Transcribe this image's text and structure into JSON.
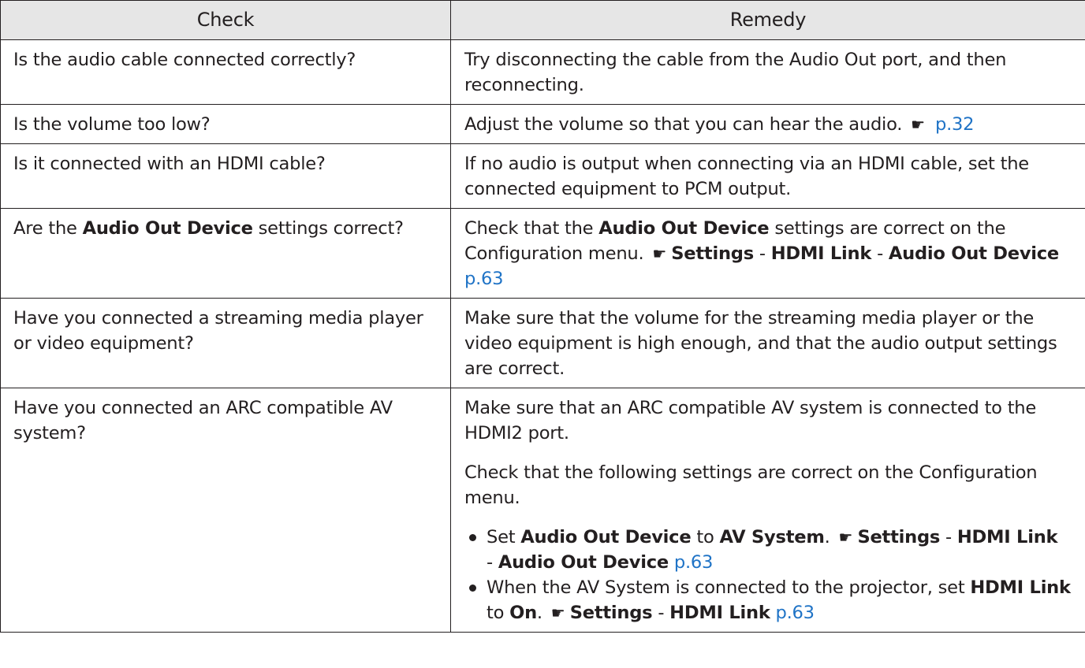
{
  "headers": {
    "check": "Check",
    "remedy": "Remedy"
  },
  "rows": [
    {
      "check": "Is the audio cable connected correctly?",
      "remedy": "Try disconnecting the cable from the Audio Out port, and then reconnecting."
    },
    {
      "check": "Is the volume too low?",
      "remedy": "Adjust the volume so that you can hear the audio.",
      "remedy_link": "p.32"
    },
    {
      "check": "Is it connected with an HDMI cable?",
      "remedy": "If no audio is output when connecting via an HDMI cable, set the connected equipment to PCM output."
    },
    {
      "check_pre": "Are the",
      "check_bold": "Audio Out Device",
      "check_post": "settings correct?",
      "remedy_pre": "Check that the",
      "remedy_bold": "Audio Out Device",
      "remedy_post": "settings are correct on the Configuration menu.",
      "path": [
        "Settings",
        "HDMI Link",
        "Audio Out Device"
      ],
      "remedy_link": "p.63"
    },
    {
      "check": "Have you connected a streaming media player or video equipment?",
      "remedy": "Make sure that the volume for the streaming media player or the video equipment is high enough, and that the audio output settings are correct."
    },
    {
      "check": "Have you connected an ARC compatible AV system?",
      "remedy_p1": "Make sure that an ARC compatible AV system is connected to the HDMI2 port.",
      "remedy_p2": "Check that the following settings are correct on the Configuration menu.",
      "bullet1": {
        "set": "Set",
        "bold1": "Audio Out Device",
        "to": "to",
        "bold2": "AV System",
        "path": [
          "Settings",
          "HDMI Link",
          "Audio Out Device"
        ],
        "link": "p.63"
      },
      "bullet2": {
        "text": "When the AV System is connected to the projector, set",
        "bold1": "HDMI Link",
        "to": "to",
        "bold2": "On",
        "path": [
          "Settings",
          "HDMI Link"
        ],
        "link": "p.63"
      }
    }
  ],
  "ref_icon": "pointing-hand-icon",
  "path_separator": "-",
  "link_color": "#1f73c6"
}
